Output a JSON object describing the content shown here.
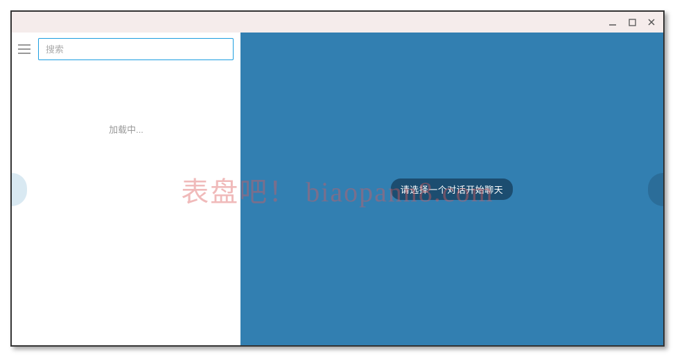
{
  "search": {
    "placeholder": "搜索",
    "value": ""
  },
  "sidebar": {
    "loading_text": "加载中..."
  },
  "chat": {
    "empty_prompt": "请选择一个对话开始聊天"
  },
  "watermark": "表盘吧！ biaopann8.com",
  "colors": {
    "accent": "#1a9de0",
    "chat_bg": "#327fb1",
    "pill_bg": "#1c4d70"
  }
}
